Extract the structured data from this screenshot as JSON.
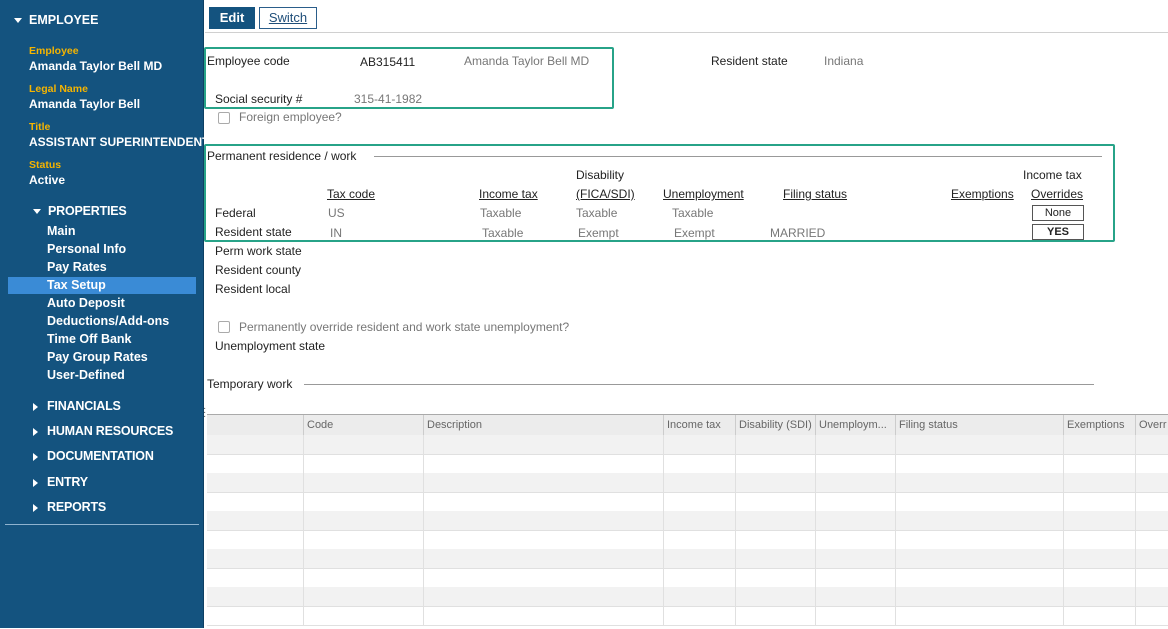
{
  "sidebar": {
    "header": "EMPLOYEE",
    "fields": [
      {
        "label": "Employee",
        "value": "Amanda Taylor Bell MD"
      },
      {
        "label": "Legal Name",
        "value": "Amanda Taylor Bell"
      },
      {
        "label": "Title",
        "value": "ASSISTANT SUPERINTENDENT"
      },
      {
        "label": "Status",
        "value": "Active"
      }
    ],
    "properties_label": "PROPERTIES",
    "properties_items": [
      "Main",
      "Personal Info",
      "Pay Rates",
      "Tax Setup",
      "Auto Deposit",
      "Deductions/Add-ons",
      "Time Off Bank",
      "Pay Group Rates",
      "User-Defined"
    ],
    "selected_item": "Tax Setup",
    "groups": [
      "FINANCIALS",
      "HUMAN RESOURCES",
      "DOCUMENTATION",
      "ENTRY",
      "REPORTS"
    ]
  },
  "toolbar": {
    "edit": "Edit",
    "switch": "Switch"
  },
  "employee": {
    "code_label": "Employee code",
    "code": "AB315411",
    "name": "Amanda Taylor Bell MD",
    "resident_state_label": "Resident state",
    "resident_state": "Indiana",
    "ssn_label": "Social security #",
    "ssn": "315-41-1982",
    "foreign_label": "Foreign employee?"
  },
  "permanent": {
    "section_label": "Permanent residence / work",
    "headers": {
      "tax_code": "Tax code",
      "income_tax": "Income tax",
      "disability_top": "Disability",
      "disability": "(FICA/SDI)",
      "unemployment": "Unemployment",
      "filing_status": "Filing status",
      "exemptions": "Exemptions",
      "overrides_top": "Income tax",
      "overrides": "Overrides"
    },
    "rows": [
      {
        "label": "Federal",
        "tax_code": "US",
        "income_tax": "Taxable",
        "disability": "Taxable",
        "unemployment": "Taxable",
        "filing_status": "",
        "override": "None"
      },
      {
        "label": "Resident state",
        "tax_code": "IN",
        "income_tax": "Taxable",
        "disability": "Exempt",
        "unemployment": "Exempt",
        "filing_status": "MARRIED",
        "override": "YES"
      }
    ],
    "extra_labels": [
      "Perm work state",
      "Resident county",
      "Resident local"
    ],
    "override_unemp_label": "Permanently override resident and work state unemployment?",
    "unemployment_state_label": "Unemployment state"
  },
  "temporary": {
    "section_label": "Temporary work",
    "columns": [
      "",
      "Code",
      "Description",
      "Income tax",
      "Disability (SDI)",
      "Unemploym...",
      "Filing status",
      "Exemptions",
      "Overr"
    ]
  },
  "colors": {
    "sidebar": "#14537f",
    "highlight": "#27a388",
    "selected": "#3a8bd6",
    "label": "#f5b400"
  }
}
